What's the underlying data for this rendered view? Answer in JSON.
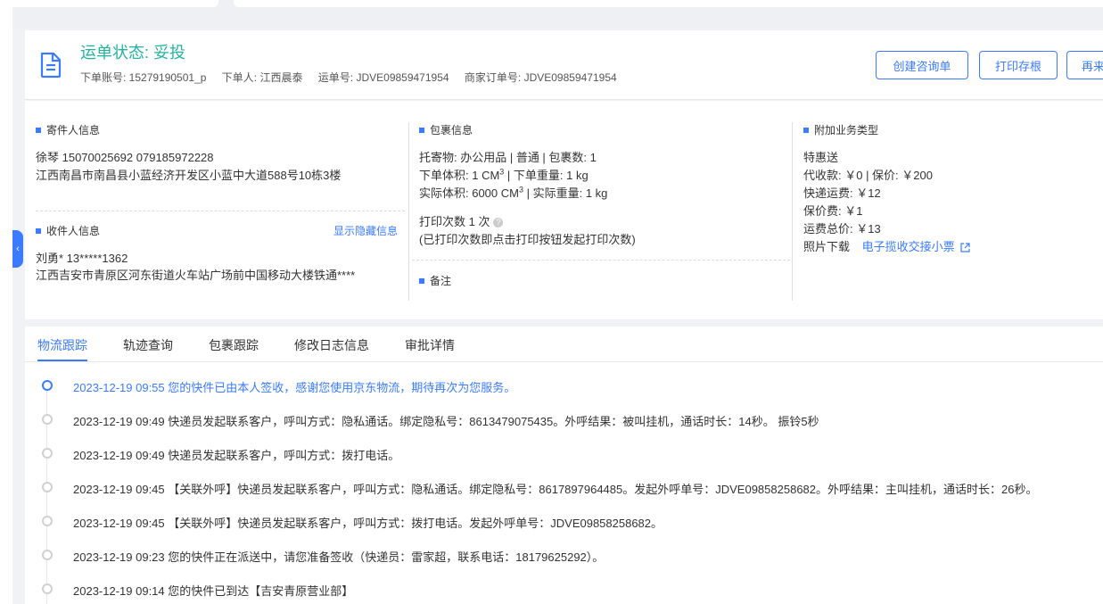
{
  "header": {
    "status": "运单状态: 妥投",
    "meta": [
      "下单账号: 15279190501_p",
      "下单人: 江西晨泰",
      "运单号: JDVE09859471954",
      "商家订单号: JDVE09859471954"
    ],
    "buttons": {
      "create_inquiry": "创建咨询单",
      "print_stub": "打印存根",
      "partial": "再来"
    }
  },
  "sender": {
    "title": "寄件人信息",
    "name_phones": "徐琴   15070025692   079185972228",
    "address": "江西南昌市南昌县小蓝经济开发区小蓝中大道588号10栋3楼"
  },
  "receiver": {
    "title": "收件人信息",
    "show_hidden": "显示隐藏信息",
    "name_phone": "刘勇*   13*****1362",
    "address": "江西吉安市青原区河东街道火车站广场前中国移动大楼铁通****"
  },
  "package": {
    "title": "包裹信息",
    "goods": "托寄物:  办公用品 | 普通  |  包裹数:  1",
    "order_volume_label": "下单体积:   1 CM",
    "order_weight": "下单重量:   1 kg",
    "actual_volume_label": "实际体积:   6000 CM",
    "actual_weight": "实际重量:   1 kg",
    "sup": "3",
    "print_count": "打印次数   1 次",
    "print_note": "(已打印次数即点击打印按钮发起打印次数)",
    "remark_title": "备注"
  },
  "extra": {
    "title": "附加业务类型",
    "service": "特惠送",
    "cod": "代收款: ￥0  |  保价: ￥200",
    "freight": "快递运费: ￥12",
    "insure_fee": "保价费: ￥1",
    "total": "运费总价: ￥13",
    "photo_label": "照片下载",
    "photo_link": "电子揽收交接小票"
  },
  "tabs": [
    "物流跟踪",
    "轨迹查询",
    "包裹跟踪",
    "修改日志信息",
    "审批详情"
  ],
  "timeline": [
    "2023-12-19 09:55 您的快件已由本人签收，感谢您使用京东物流，期待再次为您服务。",
    "2023-12-19 09:49 快递员发起联系客户，呼叫方式：隐私通话。绑定隐私号：8613479075435。外呼结果：被叫挂机，通话时长：14秒。 振铃5秒",
    "2023-12-19 09:49 快递员发起联系客户，呼叫方式：拨打电话。",
    "2023-12-19 09:45 【关联外呼】快递员发起联系客户，呼叫方式：隐私通话。绑定隐私号：8617897964485。发起外呼单号：JDVE09858258682。外呼结果：主叫挂机，通话时长：26秒。",
    "2023-12-19 09:45 【关联外呼】快递员发起联系客户，呼叫方式：拨打电话。发起外呼单号：JDVE09858258682。",
    "2023-12-19 09:23 您的快件正在派送中，请您准备签收（快递员：雷家超，联系电话：18179625292）。",
    "2023-12-19 09:14 您的快件已到达【吉安青原营业部】"
  ],
  "colors": {
    "accent": "#3a7bff",
    "status": "#22b3a0"
  }
}
